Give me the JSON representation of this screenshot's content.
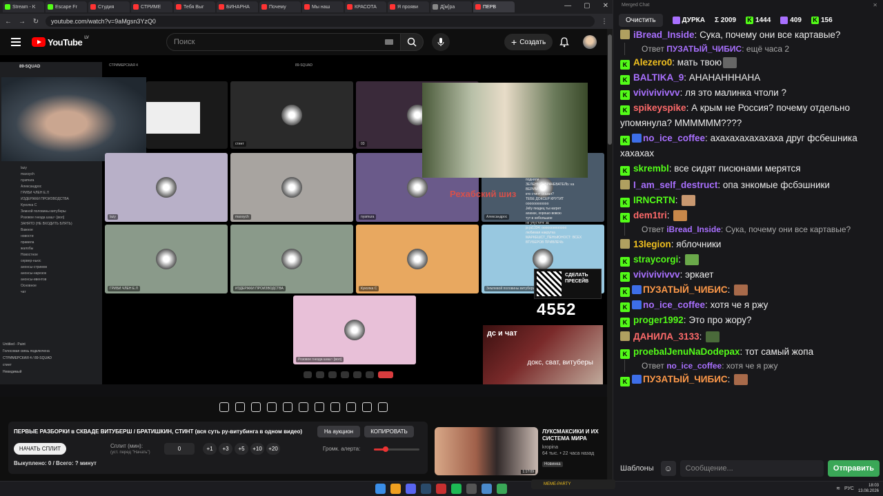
{
  "browser": {
    "tabs": [
      {
        "label": "Stream - K",
        "color": "#53fc18"
      },
      {
        "label": "Escape Fr",
        "color": "#53fc18"
      },
      {
        "label": "Студия",
        "color": "#ff3333"
      },
      {
        "label": "СТРИМЕ",
        "color": "#ff3333"
      },
      {
        "label": "Тебя Выг",
        "color": "#ff3333"
      },
      {
        "label": "БИНАРНА",
        "color": "#ff3333"
      },
      {
        "label": "Почему",
        "color": "#ff3333"
      },
      {
        "label": "Мы наш",
        "color": "#ff3333"
      },
      {
        "label": "КРАСОТА",
        "color": "#ff3333"
      },
      {
        "label": "Я прояви",
        "color": "#ff3333"
      },
      {
        "label": "Д[м]ра",
        "color": "#888888"
      },
      {
        "label": "ПЕРВ",
        "color": "#ff3333",
        "active": true
      }
    ],
    "url": "youtube.com/watch?v=9aMgsn3YzQ0"
  },
  "youtube": {
    "logo": "YouTube",
    "region": "LV",
    "search_placeholder": "Поиск",
    "create_label": "Создать"
  },
  "video": {
    "discord_server": "89-SQUAD",
    "channel_header": "СТРИМЕРСКАЯ 4",
    "top_right_title": "89-SQUAD",
    "tiles": [
      {
        "label": "стинт",
        "bg": "#2a2a2a"
      },
      {
        "label": "03",
        "bg": "#3a2a3a"
      },
      {
        "label": "lazy",
        "bg": "#b8b0c8"
      },
      {
        "label": "maxsych",
        "bg": "#a8a4a0"
      },
      {
        "label": "nyamura",
        "bg": "#6a5a8a"
      },
      {
        "label": "Александрос",
        "bg": "#4a5a6a"
      },
      {
        "label": "ГРИБИ ЧЛЕН Е.Л",
        "bg": "#8a9a8a"
      },
      {
        "label": "ИЗДЕРЖКИ ПРОИЗВОДСТВА",
        "bg": "#8a9a8a"
      },
      {
        "label": "Куколка С",
        "bg": "#e8a860"
      },
      {
        "label": "Землевой половины витуберы",
        "bg": "#98c8e0"
      },
      {
        "label": "Розовое гнезда шаш~ [вол]",
        "bg": "#e8c0d8"
      }
    ],
    "discord_list": [
      "lazy",
      "maxsych",
      "nyamura",
      "Александрос",
      "ГРИБИ ЧЛЕН Е.Л",
      "ИЗДЕРЖКИ ПРОИЗВОДСТВА",
      "Куколка С",
      "Земной половины витуберы",
      "Розовое гнезда шаш~ [вол]",
      "ЗАНЯТО (НЕ ВХОДИТЬ БЛЯТЬ)",
      "Важное",
      "новости",
      "правила",
      "жалобы",
      "Новостное",
      "сервер-ньюс",
      "анонсы-стримов",
      "анонсы-нарезок",
      "анонсы-ивентов",
      "Основное",
      "чат"
    ],
    "discord_bottom": [
      "Untitled - Paint",
      "Голосовая связь подключена",
      "СТРИМЕРСКАЯ 4 / 89-SQUAD",
      "стинт",
      "Невидимый"
    ],
    "overlay_text": "Рехабский шиз",
    "stream_chat": [
      "подняли",
      "ЗЕЛЕНЫЙ_ВРАЧЕВАТЕЛЬ: ка",
      "ВЕРИМ",
      "кто стинт сказал?",
      "ТЕБЕ ДОКСЕР КРУТИТ",
      "oooooooooooo",
      "Jeliy пиздец ты нагрет",
      "ахахах, хорошо вовсю",
      "тут в небольшое",
      "не упустите за",
      "ja ja1334: ooooooooooooo",
      "любимая накрутка",
      "МАРКЕШСТ_ПЕНЫЮНОСТ: ВСЕХ",
      "ВТУБЕРОВ ПРИВЛЕЧЬ"
    ],
    "qr_text": "СДЕЛАТЬ ПРЕСЕЙВ",
    "counter": "4552",
    "ds_title": "дс и чат",
    "ds_caption": "докс, сват, витуберы"
  },
  "panel": {
    "title": "ПЕРВЫЕ РАЗБОРКИ в СКВАДЕ ВИТУБЕРШ / БРАТИШКИН, СТИНТ (вся суть ру-витубинга в одном видео)",
    "auction_label": "На аукцион",
    "copy_label": "КОПИРОВАТЬ",
    "start_split_label": "НАЧАТЬ СПЛИТ",
    "split_label": "Сплит (мин):",
    "split_hint": "(уст. перед \"Начать\")",
    "split_value": "0",
    "increments": [
      "+1",
      "+3",
      "+5",
      "+10",
      "+20"
    ],
    "volume_label": "Громк. алерта:",
    "volume_fraction": 0.25,
    "bought_label": "Выкуплено: 0 / Всего: ? минут"
  },
  "recommended": {
    "title": "ЛУКСМАКСИКИ И ИХ СИСТЕМА МИРА",
    "channel": "kropina",
    "meta": "64 тыс. • 22 часа назад",
    "badge": "Новинка",
    "duration": "1:17:09"
  },
  "chat": {
    "window_title": "Merged Chat",
    "clear_label": "Очистить",
    "stats": [
      {
        "label": "ДУРКА",
        "icon": "twitch-icon"
      },
      {
        "label": "Σ 2009",
        "icon": "sum-icon"
      },
      {
        "label": "1444",
        "icon": "kick-icon"
      },
      {
        "label": "409",
        "icon": "twitch-icon"
      },
      {
        "label": "156",
        "icon": "kick-icon"
      }
    ],
    "messages": [
      {
        "user": "iBread_Inside",
        "color": "#a970ff",
        "text": "Сука, почему они все картавые?",
        "icon": "twitch"
      },
      {
        "reply_user": "ПУЗАТЫЙ_ЧИБИС",
        "reply_text": "ещё часа 2"
      },
      {
        "user": "Alezero0",
        "color": "#f0c020",
        "text": "мать твою",
        "icon": "kick",
        "emote": "#666"
      },
      {
        "user": "BALTIKA_9",
        "color": "#a970ff",
        "text": "АНАНАНННАНА",
        "icon": "kick"
      },
      {
        "user": "vivivivivvv",
        "color": "#a970ff",
        "text": "ля это малинка чтоли ?",
        "icon": "kick"
      },
      {
        "user": "spikeyspike",
        "color": "#ff6a6a",
        "text": "А крым не Россия? почему отдельно упомянула? ММММММ????",
        "icon": "kick"
      },
      {
        "user": "no_ice_coffee",
        "color": "#a970ff",
        "text": "ахахахахахахаха друг фсбешника хахахах",
        "icon": "kick",
        "badge": true
      },
      {
        "user": "skrembl",
        "color": "#53fc18",
        "text": "все сидят писюнами мерятся",
        "icon": "kick"
      },
      {
        "user": "I_am_self_destruct",
        "color": "#a970ff",
        "text": "опа знкомые фсбэшники",
        "icon": "twitch"
      },
      {
        "user": "IRNCRTN",
        "color": "#53fc18",
        "text": "",
        "icon": "kick",
        "emote": "#c89870"
      },
      {
        "user": "dem1tri",
        "color": "#ff6a6a",
        "text": "",
        "icon": "kick",
        "emote": "#c8884a"
      },
      {
        "reply_user": "iBread_Inside",
        "reply_text": "Сука, почему они все картавые?"
      },
      {
        "user": "13legion",
        "color": "#f0c020",
        "text": "яблочники",
        "icon": "twitch"
      },
      {
        "user": "straycorgi",
        "color": "#53fc18",
        "text": "",
        "icon": "kick",
        "emote": "#6aa84a"
      },
      {
        "user": "vivivivivvv",
        "color": "#a970ff",
        "text": "эркает",
        "icon": "kick"
      },
      {
        "user": "ПУЗАТЫЙ_ЧИБИС",
        "color": "#ff9a4a",
        "text": "",
        "icon": "kick",
        "badge": true,
        "emote": "#a86a4a"
      },
      {
        "user": "no_ice_coffee",
        "color": "#a970ff",
        "text": "хотя че я ржу",
        "icon": "kick",
        "badge": true
      },
      {
        "user": "proger1992",
        "color": "#53fc18",
        "text": "Это про жору?",
        "icon": "kick"
      },
      {
        "user": "ДАНИЛА_3133",
        "color": "#ff6a6a",
        "text": "",
        "icon": "twitch",
        "emote": "#4a6a3a"
      },
      {
        "user": "proebalJenuNaDodepax",
        "color": "#53fc18",
        "text": "тот самый жопа",
        "icon": "kick"
      },
      {
        "reply_user": "no_ice_coffee",
        "reply_text": "хотя че я ржу"
      },
      {
        "user": "ПУЗАТЫЙ_ЧИБИС",
        "color": "#ff9a4a",
        "text": "",
        "icon": "kick",
        "badge": true,
        "emote": "#a86a4a"
      }
    ],
    "reply_prefix": "Ответ",
    "templates_label": "Шаблоны",
    "input_placeholder": "Сообщение...",
    "send_label": "Отправить"
  },
  "taskbar": {
    "meme_label": "MEME-PARTY",
    "lang": "РУС",
    "time": "18:03",
    "date": "13.08.2026"
  }
}
